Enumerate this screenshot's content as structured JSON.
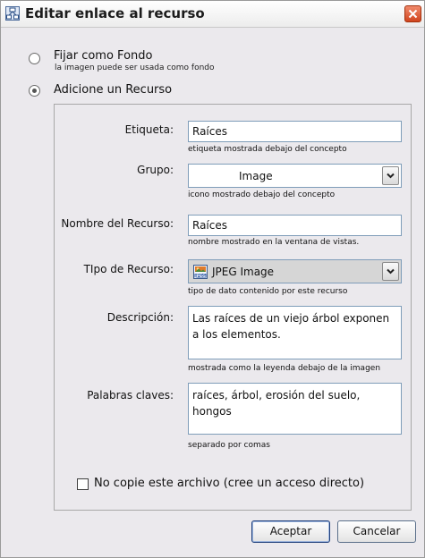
{
  "window": {
    "title": "Editar enlace al recurso"
  },
  "options": {
    "background": {
      "label": "Fijar como Fondo",
      "hint": "la imagen puede ser usada como fondo",
      "selected": false
    },
    "resource": {
      "label": "Adicione un Recurso",
      "selected": true
    }
  },
  "form": {
    "label_field": {
      "label": "Etiqueta:",
      "value": "Raíces",
      "hint": "etiqueta mostrada debajo del concepto"
    },
    "group_field": {
      "label": "Grupo:",
      "value": "Image",
      "hint": "icono mostrado debajo del concepto"
    },
    "name_field": {
      "label": "Nombre del Recurso:",
      "value": "Raíces",
      "hint": "nombre mostrado en la ventana de vistas."
    },
    "type_field": {
      "label": "TIpo de Recurso:",
      "value": "JPEG Image",
      "icon": "jpeg-file-icon",
      "hint": "tipo de dato contenido por este recurso"
    },
    "description_field": {
      "label": "Descripción:",
      "value": "Las raíces de un viejo árbol exponen a los elementos.",
      "hint": "mostrada como la leyenda debajo de la imagen"
    },
    "keywords_field": {
      "label": "Palabras claves:",
      "value": "raíces, árbol, erosión del suelo, hongos",
      "hint": "separado por comas"
    },
    "no_copy": {
      "label": "No copie este archivo  (cree un acceso directo)",
      "checked": false
    }
  },
  "buttons": {
    "accept": "Aceptar",
    "cancel": "Cancelar"
  },
  "colors": {
    "close_button": "#d0451e",
    "field_border": "#7f9db9",
    "dialog_background": "#ebe9ed"
  }
}
